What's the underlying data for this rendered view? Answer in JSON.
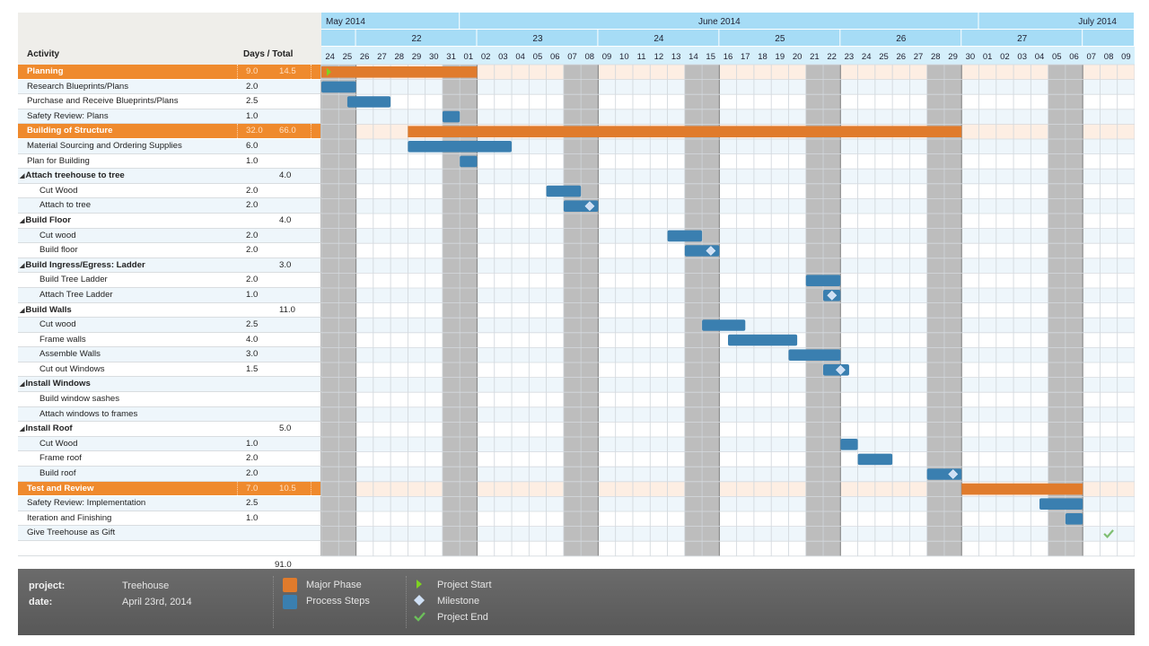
{
  "header": {
    "activity_label": "Activity",
    "days_total_label": "Days / Total"
  },
  "colors": {
    "phase": "#e07b2c",
    "process": "#3a7fb0",
    "weekend": "#bdbdbd",
    "header_blue": "#a6dcf6",
    "milestone": "#cfe0f5",
    "start": "#7ed321",
    "end": "#6cbf5a"
  },
  "footer": {
    "project_label": "project:",
    "project_value": "Treehouse",
    "date_label": "date:",
    "date_value": "April 23rd, 2014",
    "legend": {
      "major_phase": "Major Phase",
      "process_steps": "Process Steps",
      "project_start": "Project Start",
      "milestone": "Milestone",
      "project_end": "Project End"
    }
  },
  "grand_total": "91.0",
  "chart_data": {
    "type": "gantt",
    "title": "Treehouse",
    "timeline": {
      "start": "2014-05-24",
      "months": [
        {
          "label": "May 2014",
          "days": 8
        },
        {
          "label": "June 2014",
          "days": 30
        },
        {
          "label": "July 2014",
          "days": 9
        }
      ],
      "weeks": [
        {
          "label": "",
          "days": 2
        },
        {
          "label": "22",
          "days": 7
        },
        {
          "label": "23",
          "days": 7
        },
        {
          "label": "24",
          "days": 7
        },
        {
          "label": "25",
          "days": 7
        },
        {
          "label": "26",
          "days": 7
        },
        {
          "label": "27",
          "days": 7
        },
        {
          "label": "",
          "days": 3
        }
      ],
      "day_labels": [
        "24",
        "25",
        "26",
        "27",
        "28",
        "29",
        "30",
        "31",
        "01",
        "02",
        "03",
        "04",
        "05",
        "06",
        "07",
        "08",
        "09",
        "10",
        "11",
        "12",
        "13",
        "14",
        "15",
        "16",
        "17",
        "18",
        "19",
        "20",
        "21",
        "22",
        "23",
        "24",
        "25",
        "26",
        "27",
        "28",
        "29",
        "30",
        "01",
        "02",
        "03",
        "04",
        "05",
        "06",
        "07",
        "08",
        "09"
      ],
      "weekend_days": [
        0,
        1,
        7,
        8,
        14,
        15,
        21,
        22,
        28,
        29,
        35,
        36,
        42,
        43
      ]
    },
    "rows": [
      {
        "name": "Planning",
        "kind": "phase",
        "days": "9.0",
        "total": "14.5",
        "start": 0,
        "end": 9,
        "marker": "start"
      },
      {
        "name": "Research Blueprints/Plans",
        "kind": "task",
        "days": "2.0",
        "total": "",
        "start": 0,
        "end": 2
      },
      {
        "name": "Purchase and Receive Blueprints/Plans",
        "kind": "task",
        "days": "2.5",
        "total": "",
        "start": 1.5,
        "end": 4
      },
      {
        "name": "Safety Review: Plans",
        "kind": "task",
        "days": "1.0",
        "total": "",
        "start": 7,
        "end": 8
      },
      {
        "name": "Building of Structure",
        "kind": "phase",
        "days": "32.0",
        "total": "66.0",
        "start": 5,
        "end": 37
      },
      {
        "name": "Material Sourcing and Ordering Supplies",
        "kind": "task",
        "days": "6.0",
        "total": "",
        "start": 5,
        "end": 11
      },
      {
        "name": "Plan for Building",
        "kind": "task",
        "days": "1.0",
        "total": "",
        "start": 8,
        "end": 9
      },
      {
        "name": "Attach treehouse to tree",
        "kind": "group",
        "days": "",
        "total": "4.0"
      },
      {
        "name": "Cut Wood",
        "kind": "sub",
        "days": "2.0",
        "total": "",
        "start": 13,
        "end": 15
      },
      {
        "name": "Attach to tree",
        "kind": "sub",
        "days": "2.0",
        "total": "",
        "start": 14,
        "end": 16,
        "marker": "milestone"
      },
      {
        "name": "Build Floor",
        "kind": "group",
        "days": "",
        "total": "4.0"
      },
      {
        "name": "Cut wood",
        "kind": "sub",
        "days": "2.0",
        "total": "",
        "start": 20,
        "end": 22
      },
      {
        "name": "Build floor",
        "kind": "sub",
        "days": "2.0",
        "total": "",
        "start": 21,
        "end": 23,
        "marker": "milestone"
      },
      {
        "name": "Build Ingress/Egress: Ladder",
        "kind": "group",
        "days": "",
        "total": "3.0"
      },
      {
        "name": "Build Tree Ladder",
        "kind": "sub",
        "days": "2.0",
        "total": "",
        "start": 28,
        "end": 30
      },
      {
        "name": "Attach Tree Ladder",
        "kind": "sub",
        "days": "1.0",
        "total": "",
        "start": 29,
        "end": 30,
        "marker": "milestone"
      },
      {
        "name": "Build Walls",
        "kind": "group",
        "days": "",
        "total": "11.0"
      },
      {
        "name": "Cut wood",
        "kind": "sub",
        "days": "2.5",
        "total": "",
        "start": 22,
        "end": 24.5
      },
      {
        "name": "Frame walls",
        "kind": "sub",
        "days": "4.0",
        "total": "",
        "start": 23.5,
        "end": 27.5
      },
      {
        "name": "Assemble Walls",
        "kind": "sub",
        "days": "3.0",
        "total": "",
        "start": 27,
        "end": 30
      },
      {
        "name": "Cut out Windows",
        "kind": "sub",
        "days": "1.5",
        "total": "",
        "start": 29,
        "end": 30.5,
        "marker": "milestone"
      },
      {
        "name": "Install Windows",
        "kind": "group",
        "days": "",
        "total": ""
      },
      {
        "name": "Build window sashes",
        "kind": "sub",
        "days": "",
        "total": ""
      },
      {
        "name": "Attach windows to frames",
        "kind": "sub",
        "days": "",
        "total": ""
      },
      {
        "name": "Install Roof",
        "kind": "group",
        "days": "",
        "total": "5.0"
      },
      {
        "name": "Cut Wood",
        "kind": "sub",
        "days": "1.0",
        "total": "",
        "start": 30,
        "end": 31
      },
      {
        "name": "Frame roof",
        "kind": "sub",
        "days": "2.0",
        "total": "",
        "start": 31,
        "end": 33
      },
      {
        "name": "Build roof",
        "kind": "sub",
        "days": "2.0",
        "total": "",
        "start": 35,
        "end": 37,
        "marker": "milestone"
      },
      {
        "name": "Test and Review",
        "kind": "phase",
        "days": "7.0",
        "total": "10.5",
        "start": 37,
        "end": 44
      },
      {
        "name": "Safety Review: Implementation",
        "kind": "task",
        "days": "2.5",
        "total": "",
        "start": 41.5,
        "end": 44
      },
      {
        "name": "Iteration and Finishing",
        "kind": "task",
        "days": "1.0",
        "total": "",
        "start": 43,
        "end": 44
      },
      {
        "name": "Give Treehouse as Gift",
        "kind": "task",
        "days": "",
        "total": "",
        "marker": "end",
        "marker_at": 45.5
      },
      {
        "name": "",
        "kind": "task",
        "days": "",
        "total": ""
      }
    ]
  }
}
